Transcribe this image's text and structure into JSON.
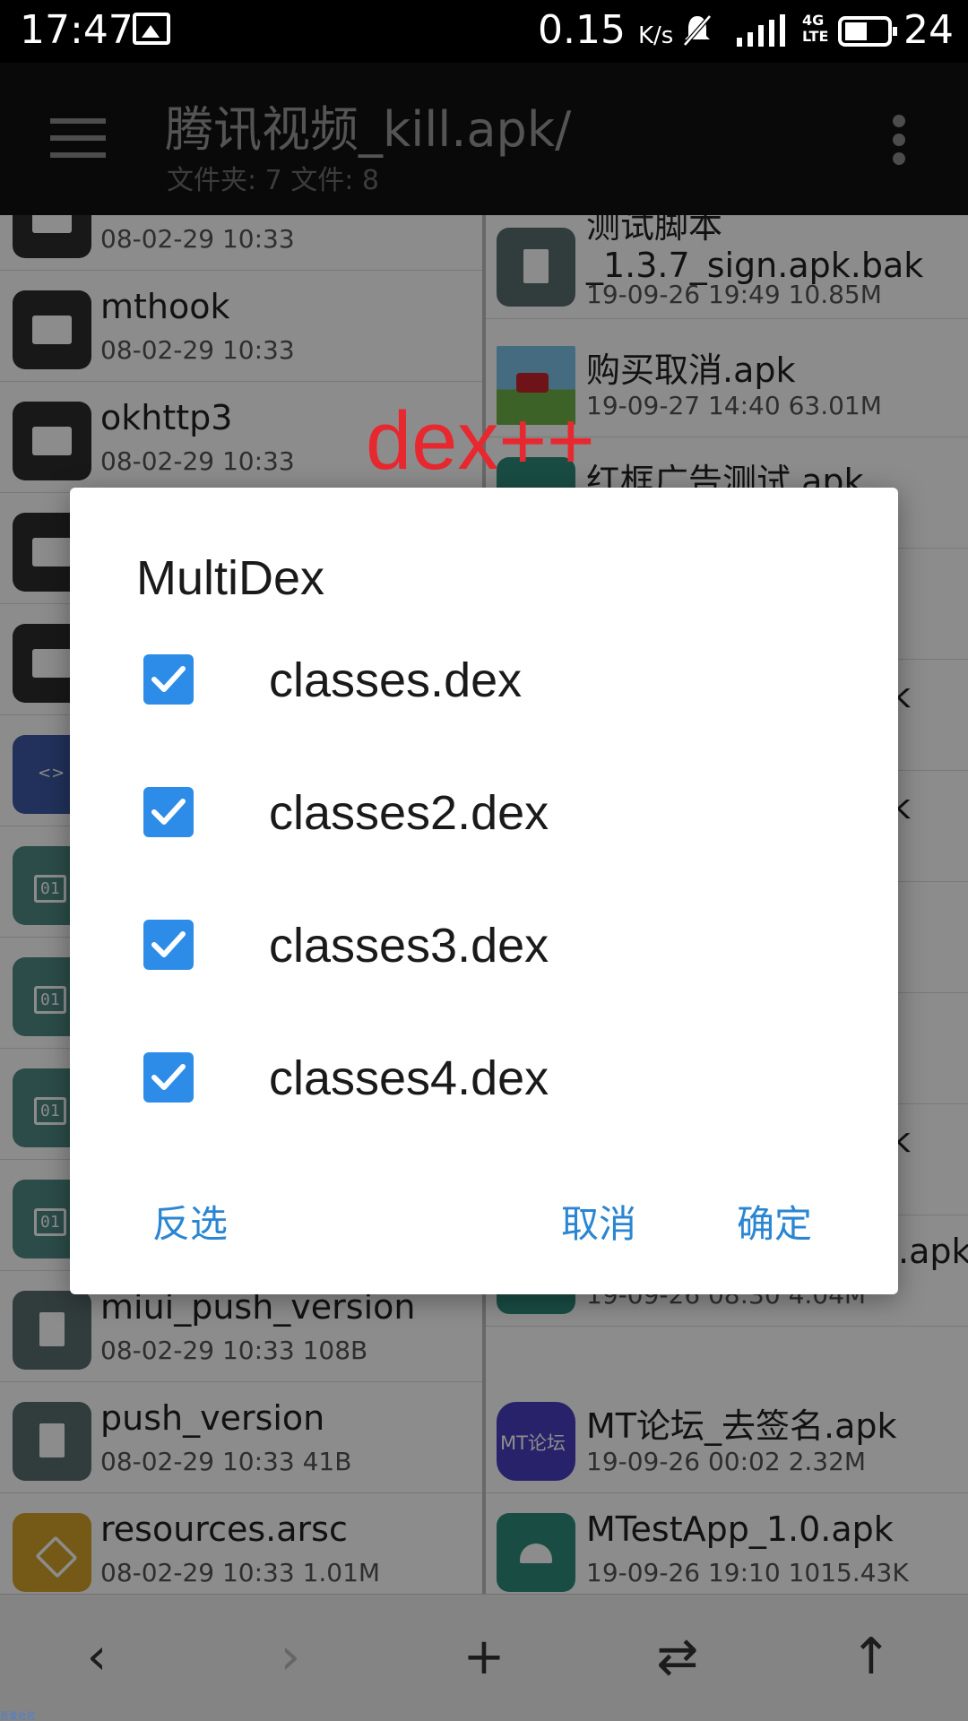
{
  "status_bar": {
    "time": "17:47",
    "net_speed": "0.15",
    "net_speed_unit": "K/s",
    "network": "4G",
    "network_sub": "LTE",
    "battery": "24"
  },
  "toolbar": {
    "title": "腾讯视频_kill.apk/",
    "subtitle": "文件夹: 7  文件: 8"
  },
  "left_pane": {
    "items": [
      {
        "name": "",
        "meta": "08-02-29 10:33",
        "icon": "folder-icon"
      },
      {
        "name": "mthook",
        "meta": "08-02-29 10:33",
        "icon": "folder-icon"
      },
      {
        "name": "okhttp3",
        "meta": "08-02-29 10:33",
        "icon": "folder-icon"
      },
      {
        "name": "",
        "meta": "",
        "icon": "folder-icon"
      },
      {
        "name": "",
        "meta": "",
        "icon": "folder-icon"
      },
      {
        "name": "",
        "meta": "",
        "icon": "code-file-icon"
      },
      {
        "name": "",
        "meta": "",
        "icon": "binary-file-icon"
      },
      {
        "name": "",
        "meta": "",
        "icon": "binary-file-icon"
      },
      {
        "name": "",
        "meta": "",
        "icon": "binary-file-icon"
      },
      {
        "name": "",
        "meta": "",
        "icon": "binary-file-icon"
      },
      {
        "name": "miui_push_version",
        "meta": "08-02-29 10:33  108B",
        "icon": "file-icon"
      },
      {
        "name": "push_version",
        "meta": "08-02-29 10:33  41B",
        "icon": "file-icon"
      },
      {
        "name": "resources.arsc",
        "meta": "08-02-29 10:33  1.01M",
        "icon": "resources-icon"
      }
    ]
  },
  "right_pane": {
    "items": [
      {
        "name": "测试脚本_1.3.7_sign.apk.bak",
        "meta": "19-09-26 19:49  10.85M",
        "icon": "file-icon"
      },
      {
        "name": "购买取消.apk",
        "meta": "19-09-27 14:40  63.01M",
        "icon": "game-app-icon"
      },
      {
        "name": "红框广告测试.apk",
        "meta": "",
        "icon": "android-icon"
      },
      {
        "name": "",
        "meta": "",
        "icon": "android-icon"
      },
      {
        "name": "k",
        "meta": "",
        "icon": "android-icon"
      },
      {
        "name": "k",
        "meta": "",
        "icon": "android-icon"
      },
      {
        "name": "",
        "meta": "",
        "icon": "android-icon"
      },
      {
        "name": "",
        "meta": "",
        "icon": "android-icon"
      },
      {
        "name": "k",
        "meta": "",
        "icon": "android-icon"
      },
      {
        "name": ".apk",
        "meta": "19-09-26 08:30  4.04M",
        "icon": "android-icon"
      },
      {
        "name": "MT论坛_去签名.apk",
        "meta": "19-09-26 00:02  2.32M",
        "icon": "mt-forum-icon"
      },
      {
        "name": "MTestApp_1.0.apk",
        "meta": "19-09-26 19:10  1015.43K",
        "icon": "android-icon"
      }
    ]
  },
  "watermark": "dex++",
  "dialog": {
    "title": "MultiDex",
    "items": [
      {
        "label": "classes.dex",
        "checked": true
      },
      {
        "label": "classes2.dex",
        "checked": true
      },
      {
        "label": "classes3.dex",
        "checked": true
      },
      {
        "label": "classes4.dex",
        "checked": true
      }
    ],
    "invert_label": "反选",
    "cancel_label": "取消",
    "ok_label": "确定"
  },
  "bottom_bar": {
    "back": "‹",
    "forward": "›",
    "add": "+",
    "swap": "⇄",
    "up": "↑"
  },
  "credit": "吾爱社区",
  "colors": {
    "accent": "#2c8ce8",
    "button_text": "#2a86d2",
    "watermark": "#e8282f"
  }
}
